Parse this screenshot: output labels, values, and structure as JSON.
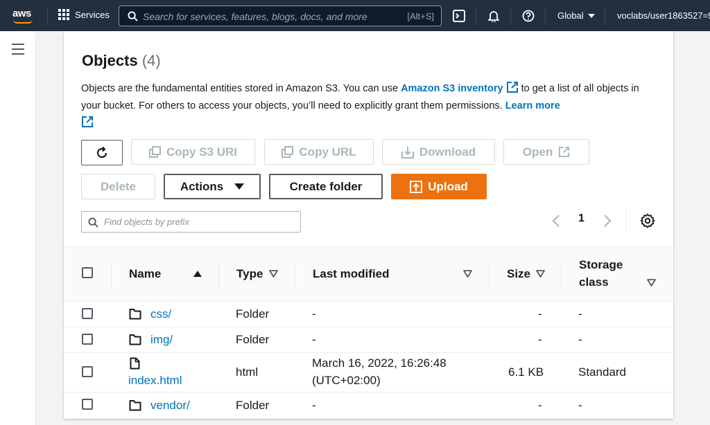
{
  "topbar": {
    "logo": "aws",
    "services_label": "Services",
    "search_placeholder": "Search for services, features, blogs, docs, and more",
    "search_shortcut": "[Alt+S]",
    "region": "Global",
    "user": "voclabs/user1863527=9"
  },
  "panel": {
    "title": "Objects",
    "count": "(4)",
    "desc_part1": "Objects are the fundamental entities stored in Amazon S3. You can use ",
    "inventory_link": "Amazon S3 inventory",
    "desc_part2": " to get a list of all objects in your bucket. For others to access your objects, you’ll need to explicitly grant them permissions. ",
    "learn_more": "Learn more"
  },
  "toolbar": {
    "copy_s3_uri": "Copy S3 URI",
    "copy_url": "Copy URL",
    "download": "Download",
    "open": "Open",
    "delete": "Delete",
    "actions": "Actions",
    "create_folder": "Create folder",
    "upload": "Upload"
  },
  "filter": {
    "placeholder": "Find objects by prefix"
  },
  "pagination": {
    "page": "1"
  },
  "table": {
    "headers": {
      "name": "Name",
      "type": "Type",
      "last_modified": "Last modified",
      "size": "Size",
      "storage_class_1": "Storage",
      "storage_class_2": "class"
    },
    "rows": [
      {
        "name": "css/",
        "type": "Folder",
        "modified": "-",
        "size": "-",
        "storage": "-"
      },
      {
        "name": "img/",
        "type": "Folder",
        "modified": "-",
        "size": "-",
        "storage": "-"
      },
      {
        "name": "index.html",
        "type": "html",
        "modified_1": "March 16, 2022, 16:26:48",
        "modified_2": "(UTC+02:00)",
        "size": "6.1 KB",
        "storage": "Standard"
      },
      {
        "name": "vendor/",
        "type": "Folder",
        "modified": "-",
        "size": "-",
        "storage": "-"
      }
    ]
  }
}
